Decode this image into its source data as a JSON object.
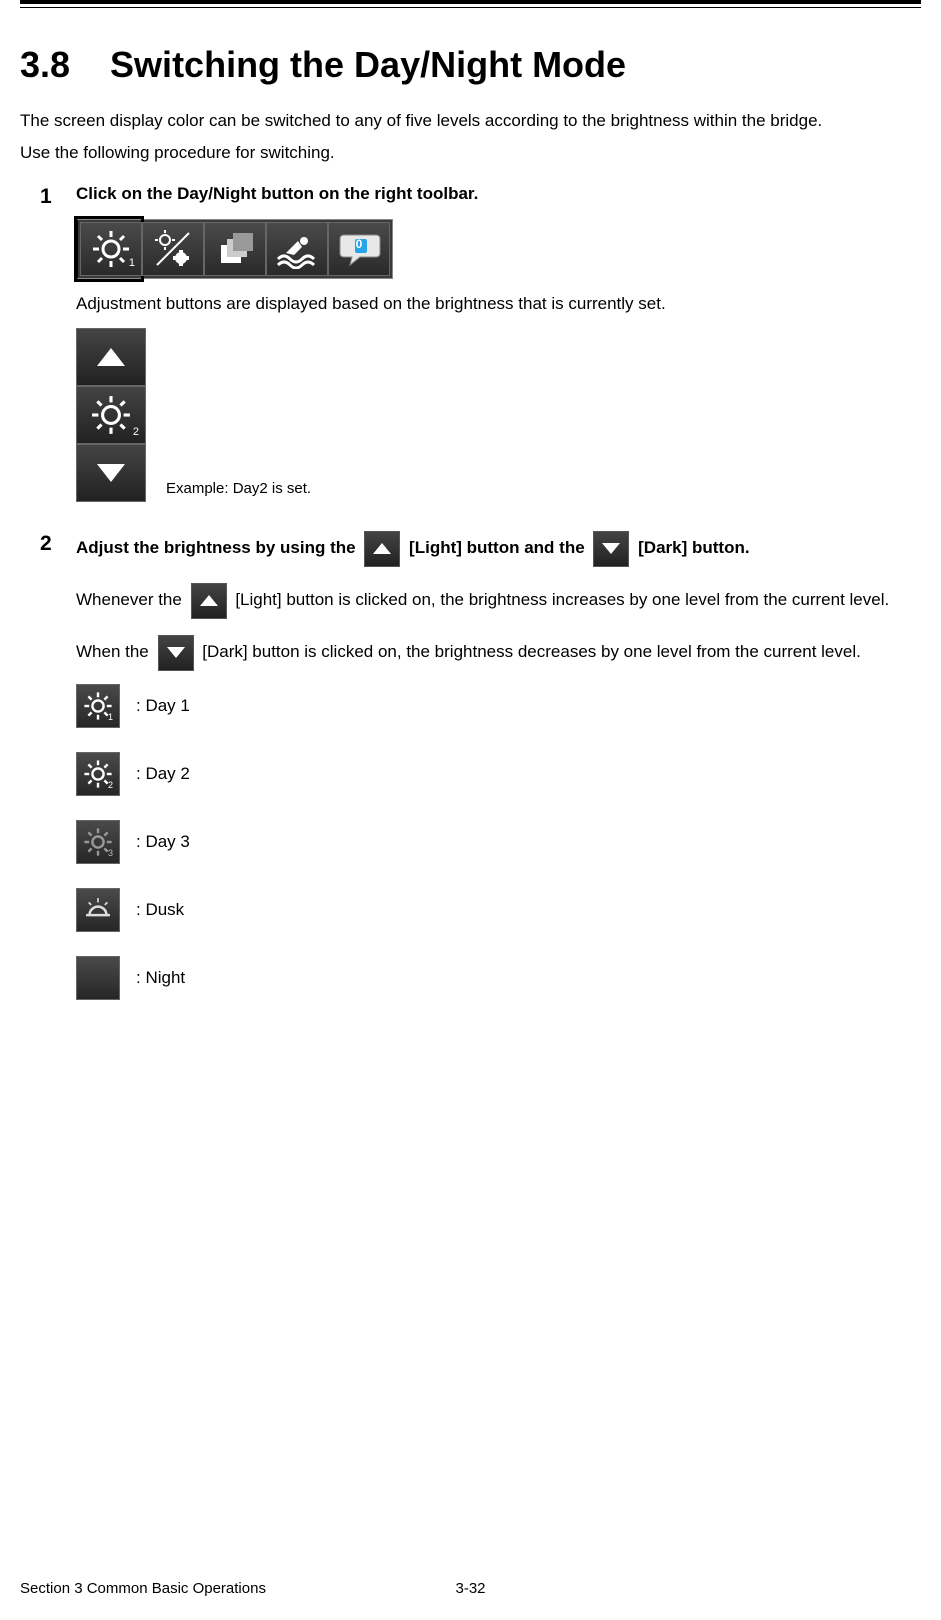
{
  "section": {
    "number": "3.8",
    "title": "Switching the Day/Night Mode"
  },
  "intro": {
    "p1": "The screen display color can be switched to any of five levels according to the brightness within the bridge.",
    "p2": "Use the following procedure for switching."
  },
  "steps": {
    "s1": {
      "num": "1",
      "title": "Click on the Day/Night button on the right toolbar.",
      "after_toolbar": "Adjustment buttons are displayed based on the brightness that is currently set.",
      "panel_caption": "Example: Day2 is set."
    },
    "s2": {
      "num": "2",
      "title_pre": "Adjust the brightness by using the",
      "title_light": "[Light] button and the",
      "title_dark": "[Dark] button.",
      "p1_pre": "Whenever the",
      "p1_post": "[Light] button is clicked on, the brightness increases by one level from the current level.",
      "p2_pre": "When the",
      "p2_post": "[Dark] button is clicked on, the brightness decreases by one level from the current level."
    }
  },
  "modes": {
    "m1": ": Day 1",
    "m2": ": Day 2",
    "m3": ": Day 3",
    "m4": ": Dusk",
    "m5": ": Night"
  },
  "toolbar_bubble": "0",
  "footer": {
    "left": "Section 3    Common Basic Operations",
    "center": "3-32"
  }
}
